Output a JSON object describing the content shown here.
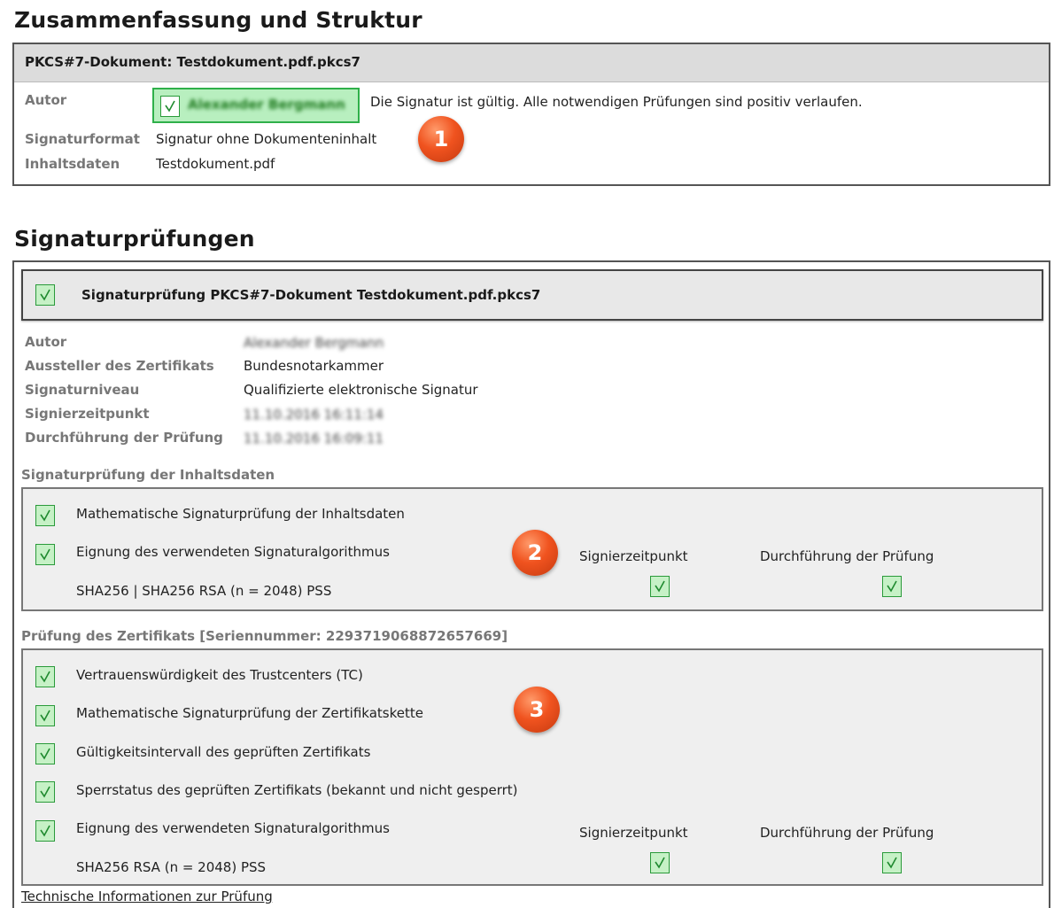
{
  "summary": {
    "heading": "Zusammenfassung und Struktur",
    "doc_title": "PKCS#7-Dokument: Testdokument.pdf.pkcs7",
    "author_label": "Autor",
    "author_name_blurred": "Alexander Bergmann",
    "status_text": "Die Signatur ist gültig. Alle notwendigen Prüfungen sind positiv verlaufen.",
    "format_label": "Signaturformat",
    "format_value": "Signatur ohne Dokumenteninhalt",
    "content_label": "Inhaltsdaten",
    "content_value": "Testdokument.pdf",
    "badge": "1"
  },
  "checks": {
    "heading": "Signaturprüfungen",
    "panel_title": "Signaturprüfung PKCS#7-Dokument Testdokument.pdf.pkcs7",
    "details": {
      "author_label": "Autor",
      "author_value_blurred": "Alexander Bergmann",
      "issuer_label": "Aussteller des Zertifikats",
      "issuer_value": "Bundesnotarkammer",
      "level_label": "Signaturniveau",
      "level_value": "Qualifizierte elektronische Signatur",
      "signing_time_label": "Signierzeitpunkt",
      "signing_time_value_blurred": "11.10.2016 16:11:14",
      "check_time_label": "Durchführung der Prüfung",
      "check_time_value_blurred": "11.10.2016 16:09:11"
    },
    "content_section": {
      "title": "Signaturprüfung der Inhaltsdaten",
      "item1": "Mathematische Signaturprüfung der Inhaltsdaten",
      "item2": "Eignung des verwendeten Signaturalgorithmus",
      "algorithm": "SHA256 | SHA256 RSA (n = 2048) PSS",
      "col1": "Signierzeitpunkt",
      "col2": "Durchführung der Prüfung",
      "badge": "2"
    },
    "cert_section": {
      "title": "Prüfung des Zertifikats [Seriennummer: 2293719068872657669]",
      "item1": "Vertrauenswürdigkeit des Trustcenters (TC)",
      "item2": "Mathematische Signaturprüfung der Zertifikatskette",
      "item3": "Gültigkeitsintervall des geprüften Zertifikats",
      "item4": "Sperrstatus des geprüften Zertifikats (bekannt und nicht gesperrt)",
      "item5": "Eignung des verwendeten Signaturalgorithmus",
      "algorithm": "SHA256 RSA (n = 2048) PSS",
      "col1": "Signierzeitpunkt",
      "col2": "Durchführung der Prüfung",
      "badge": "3"
    },
    "tech_link": "Technische Informationen zur Prüfung"
  },
  "colors": {
    "check_fill": "#c6f1c6",
    "check_border": "#2a9a3a",
    "badge": "#f0531f"
  }
}
